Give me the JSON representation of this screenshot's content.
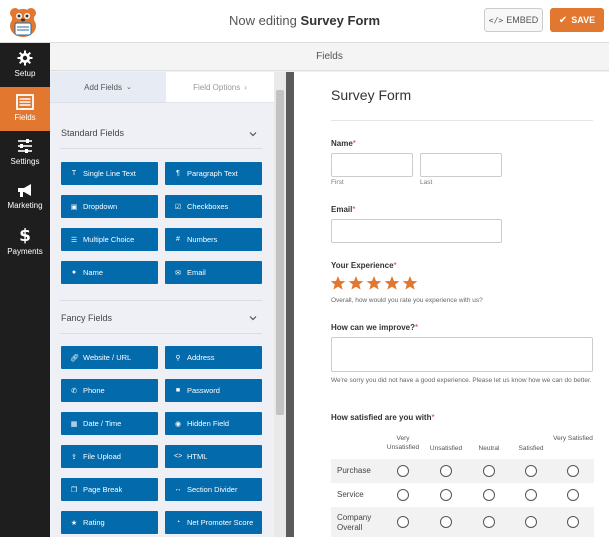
{
  "header": {
    "title_prefix": "Now editing",
    "title_form": "Survey Form",
    "embed_label": "EMBED",
    "embed_icon": "code-icon",
    "save_label": "SAVE",
    "save_icon": "checkmark-icon"
  },
  "nav": {
    "items": [
      {
        "label": "Setup",
        "icon": "gear-icon"
      },
      {
        "label": "Fields",
        "icon": "list-icon"
      },
      {
        "label": "Settings",
        "icon": "sliders-icon"
      },
      {
        "label": "Marketing",
        "icon": "megaphone-icon"
      },
      {
        "label": "Payments",
        "icon": "dollar-icon"
      }
    ],
    "active": "Fields"
  },
  "section_title": "Fields",
  "panel": {
    "tabs": {
      "add_fields": "Add Fields",
      "field_options": "Field Options"
    },
    "standard": {
      "title": "Standard Fields",
      "buttons": [
        "Single Line Text",
        "Paragraph Text",
        "Dropdown",
        "Checkboxes",
        "Multiple Choice",
        "Numbers",
        "Name",
        "Email"
      ]
    },
    "fancy": {
      "title": "Fancy Fields",
      "buttons": [
        "Website / URL",
        "Address",
        "Phone",
        "Password",
        "Date / Time",
        "Hidden Field",
        "File Upload",
        "HTML",
        "Page Break",
        "Section Divider",
        "Rating",
        "Net Promoter Score"
      ]
    }
  },
  "form": {
    "title": "Survey Form",
    "name": {
      "label": "Name",
      "required": "*",
      "first": "First",
      "last": "Last"
    },
    "email": {
      "label": "Email",
      "required": "*"
    },
    "experience": {
      "label": "Your Experience",
      "required": "*",
      "stars": 5,
      "description": "Overall, how would you rate you experience with us?"
    },
    "improve": {
      "label": "How can we improve?",
      "required": "*",
      "description": "We're sorry you did not have a good experience. Please let us know how we can do better."
    },
    "likert": {
      "label": "How satisfied are you with",
      "required": "*",
      "columns": [
        "Very Unsatisfied",
        "Unsatisfied",
        "Neutral",
        "Satisfied",
        "Very Satisfied"
      ],
      "rows": [
        "Purchase",
        "Service",
        "Company Overall"
      ]
    }
  },
  "colors": {
    "brand_orange": "#e27730",
    "field_button": "#036aab",
    "star": "#e27730",
    "nav_bg": "#1e1e1e"
  }
}
